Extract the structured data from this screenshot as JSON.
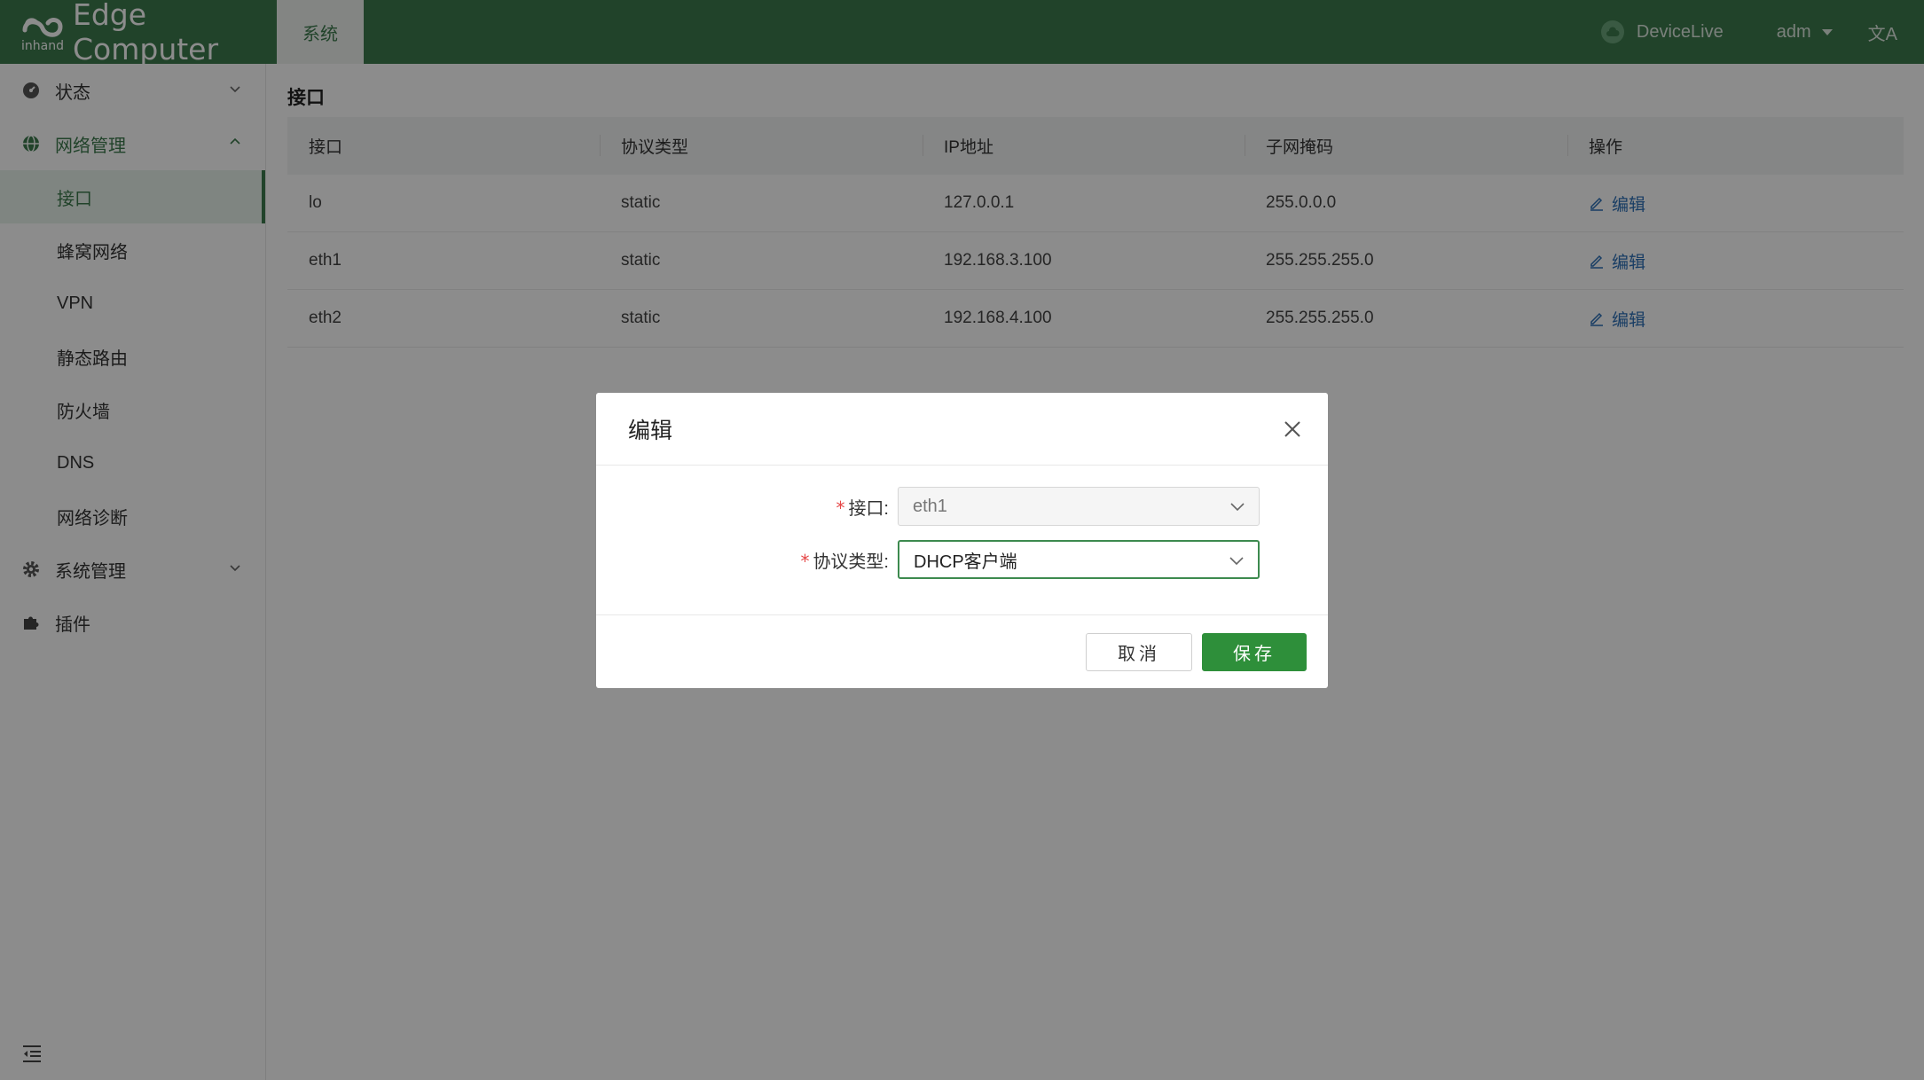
{
  "header": {
    "brand_text": "Edge Computer",
    "logo_small_text": "inhand",
    "nav_tab": "系统",
    "devicelive": "DeviceLive",
    "user": "adm",
    "lang_glyph": "文A"
  },
  "sidebar": {
    "groups": [
      {
        "label": "状态"
      },
      {
        "label": "网络管理"
      },
      {
        "label": "系统管理"
      },
      {
        "label": "插件"
      }
    ],
    "network_items": [
      "接口",
      "蜂窝网络",
      "VPN",
      "静态路由",
      "防火墙",
      "DNS",
      "网络诊断"
    ]
  },
  "main": {
    "title": "接口",
    "columns": [
      "接口",
      "协议类型",
      "IP地址",
      "子网掩码",
      "操作"
    ],
    "rows": [
      {
        "iface": "lo",
        "proto": "static",
        "ip": "127.0.0.1",
        "mask": "255.0.0.0",
        "action": "编辑"
      },
      {
        "iface": "eth1",
        "proto": "static",
        "ip": "192.168.3.100",
        "mask": "255.255.255.0",
        "action": "编辑"
      },
      {
        "iface": "eth2",
        "proto": "static",
        "ip": "192.168.4.100",
        "mask": "255.255.255.0",
        "action": "编辑"
      }
    ]
  },
  "modal": {
    "title": "编辑",
    "fields": {
      "iface_label": "接口:",
      "iface_value": "eth1",
      "proto_label": "协议类型:",
      "proto_value": "DHCP客户端",
      "required_mark": "*"
    },
    "cancel": "取消",
    "save": "保存"
  },
  "colors": {
    "brand": "#3d7a4e",
    "save_button": "#2e8f3a",
    "link": "#2d6fb7",
    "required": "#e54545"
  }
}
